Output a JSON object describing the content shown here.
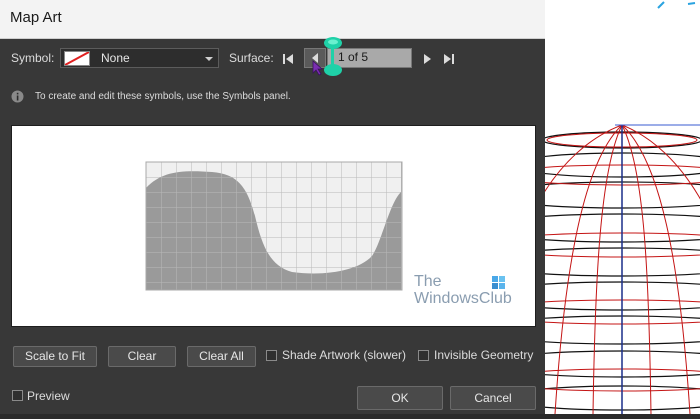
{
  "window": {
    "title": "Map Art"
  },
  "symbol": {
    "label": "Symbol:",
    "value": "None"
  },
  "surface": {
    "label": "Surface:",
    "value": "1 of 5"
  },
  "info": {
    "text": "To create and edit these symbols, use the Symbols panel."
  },
  "watermark": {
    "line1": "The",
    "line2": "WindowsClub"
  },
  "buttons": {
    "scale_to_fit": "Scale to Fit",
    "clear": "Clear",
    "clear_all": "Clear All",
    "ok": "OK",
    "cancel": "Cancel"
  },
  "checkboxes": {
    "shade_artwork": {
      "label": "Shade Artwork (slower)",
      "checked": false
    },
    "invisible_geometry": {
      "label": "Invisible Geometry",
      "checked": false
    },
    "preview": {
      "label": "Preview",
      "checked": false
    }
  },
  "colors": {
    "dialog_bg": "#383838",
    "accent_teal": "#1fd1a8",
    "wire_red": "#c41414",
    "wire_black": "#111111"
  }
}
